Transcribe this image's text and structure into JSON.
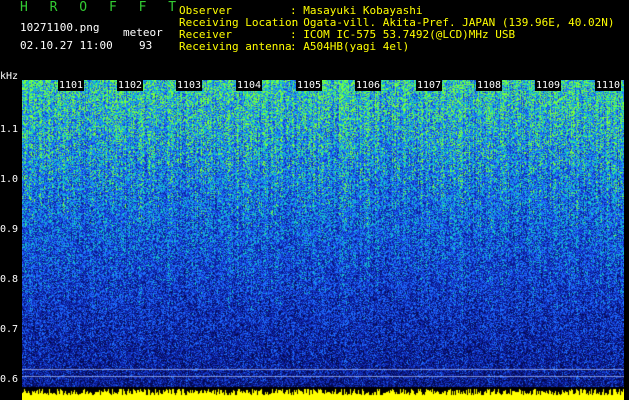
{
  "header": {
    "title": "H R O F F T",
    "filename": "10271100.png",
    "mode": "meteor",
    "datetime": "02.10.27 11:00",
    "count": "93"
  },
  "info": {
    "rows": [
      {
        "label": "Observer",
        "value": ": Masayuki Kobayashi"
      },
      {
        "label": "Receiving Location",
        "value": ": Ogata-vill. Akita-Pref. JAPAN (139.96E, 40.02N)"
      },
      {
        "label": "Receiver",
        "value": ": ICOM IC-575 53.7492(@LCD)MHz USB"
      },
      {
        "label": "Receiving antenna",
        "value": ": A504HB(yagi 4el)"
      }
    ]
  },
  "axis": {
    "unit": "kHz",
    "ticks": [
      "1.1",
      "1.0",
      "0.9",
      "0.8",
      "0.7",
      "0.6"
    ],
    "time_labels": [
      "1101",
      "1102",
      "1103",
      "1104",
      "1105",
      "1106",
      "1107",
      "1108",
      "1109",
      "1110"
    ]
  },
  "colors": {
    "background": "#000000",
    "info_text": "#ffff00",
    "title": "#33cc33",
    "noise_low": "#0a1a8a",
    "noise_mid": "#1f6fff",
    "noise_high": "#7fff3f",
    "bottom_band": "#ffff00"
  }
}
